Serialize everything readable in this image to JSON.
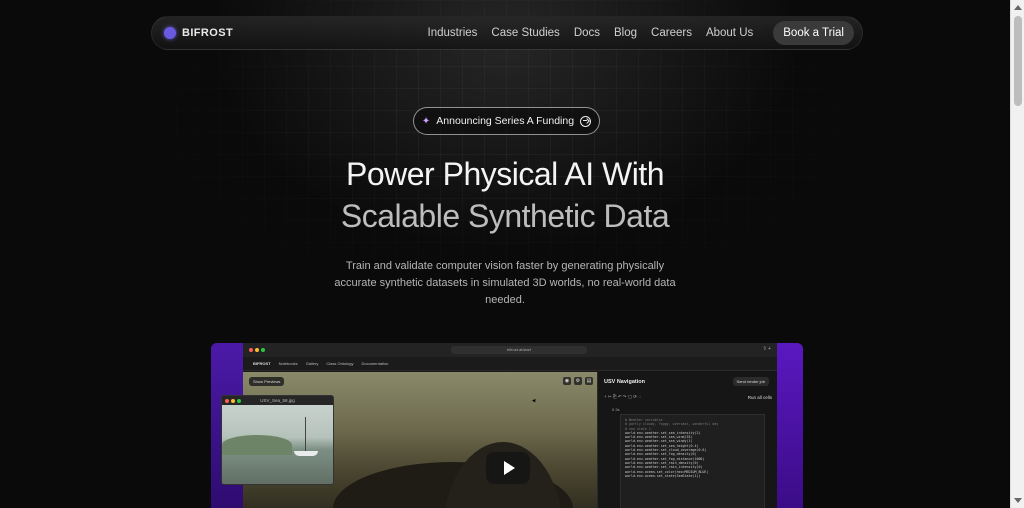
{
  "nav": {
    "brand": "BIFROST",
    "links": [
      "Industries",
      "Case Studies",
      "Docs",
      "Blog",
      "Careers",
      "About Us"
    ],
    "cta": "Book a Trial"
  },
  "hero": {
    "announcement": "Announcing Series A Funding",
    "title_line1": "Power Physical AI With",
    "title_line2": "Scalable Synthetic Data",
    "subtitle": "Train and validate computer vision faster by generating physically accurate synthetic datasets in simulated 3D worlds, no real-world data needed."
  },
  "demo": {
    "url": "bifrost.ai/start",
    "app_brand": "BIFROST",
    "app_menu": [
      "Notebooks",
      "Gallery",
      "Class Ontology",
      "Documentation"
    ],
    "show_button": "Show Previews",
    "pip_title": "USV_Sea_58.jpg",
    "panel_title": "USV Navigation",
    "send_button": "Send render job",
    "run_all": "Run all cells",
    "cell_label": "0 2s",
    "code_comment": "# Weather variables\n# partly cloudy, foggy, overcast, wonderful day\n# sea state 1",
    "code_lines": [
      "world.env.weather.set_sea_intensity(2)",
      "world.env.weather.set_sea_wind(35)",
      "world.env.weather.set_sea_windy(1)",
      "world.env.weather.set_sea_height(0.4)",
      "world.env.weather.set_cloud_coverage(0.6)",
      "world.env.weather.set_fog_density(0)",
      "world.env.weather.set_fog_distance(1000)",
      "world.env.weather.set_rain_density(0)",
      "world.env.weather.set_rain_intensity(0)",
      "world.env.ocean.set_color(hex=MEDIUM_BLUE)",
      "world.env.ocean.set_state(SeaState(1))"
    ]
  }
}
